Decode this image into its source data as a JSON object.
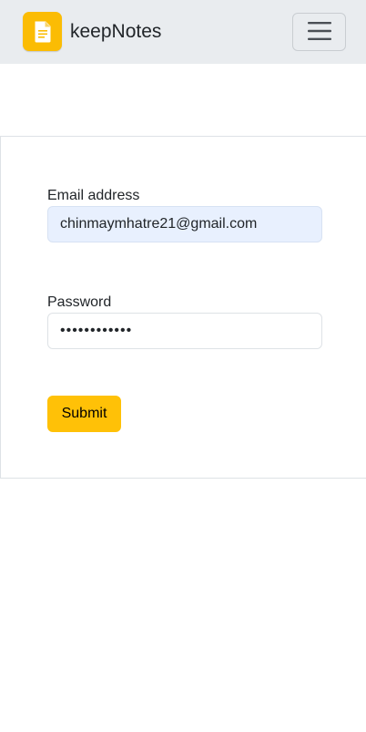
{
  "navbar": {
    "brand_name": "keepNotes",
    "brand_icon": "note-document-icon",
    "toggle_icon": "hamburger-menu-icon",
    "background_color": "#e9ecef",
    "brand_color": "#fbbc04"
  },
  "form": {
    "email_label": "Email address",
    "email_value": "chinmaymhatre21@gmail.com",
    "password_label": "Password",
    "password_value": "••••••••••••",
    "submit_label": "Submit",
    "submit_color": "#ffc107",
    "autofill_color": "#e8f0fe"
  }
}
